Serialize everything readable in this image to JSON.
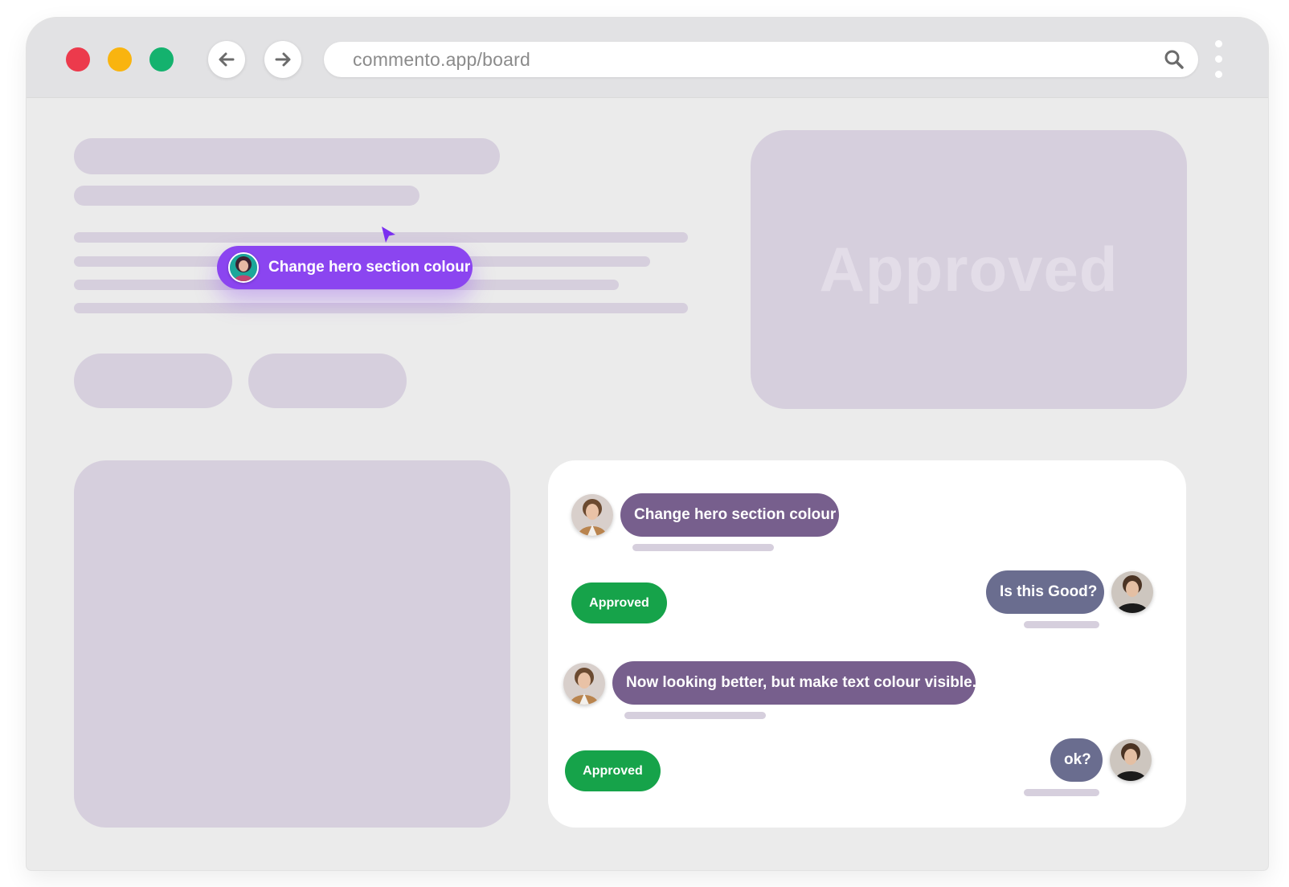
{
  "browser": {
    "url": "commento.app/board",
    "back_icon": "arrow-left-icon",
    "forward_icon": "arrow-right-icon",
    "search_icon": "search-icon",
    "menu_icon": "kebab-menu-icon",
    "traffic_lights": [
      "#ec3a4c",
      "#f9b40f",
      "#14b26e"
    ]
  },
  "canvas": {
    "hero_image_watermark": "Approved",
    "floating_comment": {
      "text": "Change hero section colour",
      "color": "#8b45f0"
    },
    "skeleton_color": "#d6cfdd"
  },
  "chat": {
    "messages": [
      {
        "text": "Change hero section colour",
        "side": "left",
        "color": "#775f8d"
      },
      {
        "text": "Is this Good?",
        "side": "right",
        "color": "#6a6d8f"
      },
      {
        "text": "Now looking better, but make text colour visible.",
        "side": "left",
        "color": "#775f8d"
      },
      {
        "text": "ok?",
        "side": "right",
        "color": "#6a6d8f"
      }
    ],
    "approved_label_1": "Approved",
    "approved_label_2": "Approved",
    "approved_color": "#16a34a"
  }
}
